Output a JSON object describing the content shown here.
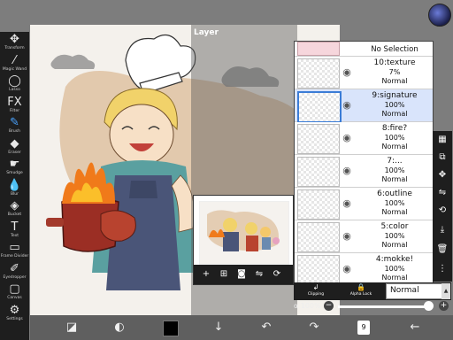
{
  "panel_title": "Layer",
  "left_tools": [
    {
      "label": "Transform",
      "icon": "move-icon",
      "glyph": "✥"
    },
    {
      "label": "Magic Wand",
      "icon": "magic-wand-icon",
      "glyph": "⁄"
    },
    {
      "label": "Lasso",
      "icon": "lasso-icon",
      "glyph": "◯"
    },
    {
      "label": "Filter",
      "icon": "fx-icon",
      "glyph": "FX"
    },
    {
      "label": "Brush",
      "icon": "brush-icon",
      "glyph": "✎"
    },
    {
      "label": "Eraser",
      "icon": "eraser-icon",
      "glyph": "◆"
    },
    {
      "label": "Smudge",
      "icon": "smudge-icon",
      "glyph": "☛"
    },
    {
      "label": "Blur",
      "icon": "blur-icon",
      "glyph": "💧"
    },
    {
      "label": "Bucket",
      "icon": "bucket-icon",
      "glyph": "◈"
    },
    {
      "label": "Text",
      "icon": "text-icon",
      "glyph": "T"
    },
    {
      "label": "Frame Divider",
      "icon": "frame-divider-icon",
      "glyph": "▭"
    },
    {
      "label": "Eyedropper",
      "icon": "eyedropper-icon",
      "glyph": "✐"
    },
    {
      "label": "Canvas",
      "icon": "canvas-icon",
      "glyph": "▢"
    },
    {
      "label": "Settings",
      "icon": "gear-icon",
      "glyph": "⚙"
    }
  ],
  "layers": {
    "no_selection": "No Selection",
    "items": [
      {
        "name": "10:texture",
        "opacity": "7%",
        "blend": "Normal",
        "selected": false
      },
      {
        "name": "9:signature",
        "opacity": "100%",
        "blend": "Normal",
        "selected": true
      },
      {
        "name": "8:fire?",
        "opacity": "100%",
        "blend": "Normal",
        "selected": false
      },
      {
        "name": "7:...",
        "opacity": "100%",
        "blend": "Normal",
        "selected": false
      },
      {
        "name": "6:outline",
        "opacity": "100%",
        "blend": "Normal",
        "selected": false
      },
      {
        "name": "5:color",
        "opacity": "100%",
        "blend": "Normal",
        "selected": false
      },
      {
        "name": "4:mokke!",
        "opacity": "100%",
        "blend": "Normal",
        "selected": false
      }
    ]
  },
  "blend_bar": {
    "clipping_label": "Clipping",
    "alpha_lock_label": "Alpha Lock",
    "blend_mode": "Normal"
  },
  "alpha": {
    "label": "α 100%",
    "value_percent": 100
  },
  "bottom": {
    "page_number": "9"
  },
  "colors": {
    "selected_layer": "#d9e4fb",
    "toolbar_bg": "#1e1e1e",
    "current_color": "#000000"
  }
}
